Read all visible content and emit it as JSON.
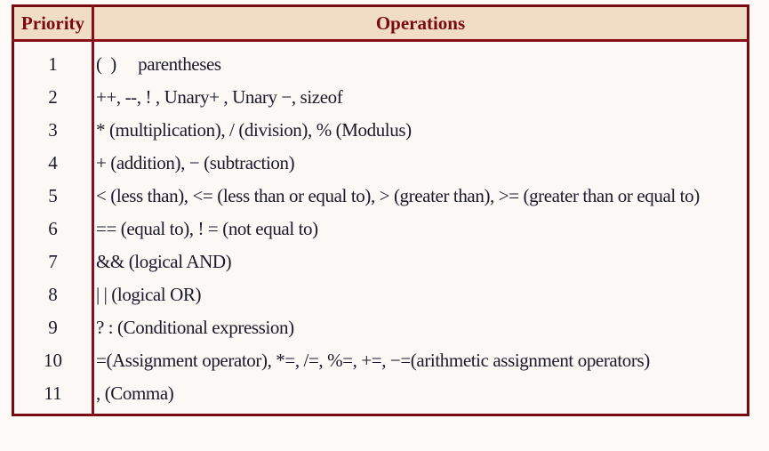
{
  "table": {
    "headers": {
      "priority": "Priority",
      "operations": "Operations"
    },
    "rows": [
      {
        "priority": "1",
        "operations": "(  )     parentheses"
      },
      {
        "priority": "2",
        "operations": "++, --, ! , Unary+ , Unary −, sizeof"
      },
      {
        "priority": "3",
        "operations": "* (multiplication), / (division), % (Modulus)"
      },
      {
        "priority": "4",
        "operations": "+ (addition), − (subtraction)"
      },
      {
        "priority": "5",
        "operations": "< (less than), <= (less than or equal to), > (greater than), >= (greater than or equal to)"
      },
      {
        "priority": "6",
        "operations": "== (equal to), ! = (not equal to)"
      },
      {
        "priority": "7",
        "operations": "&& (logical AND)"
      },
      {
        "priority": "8",
        "operations": "| | (logical OR)"
      },
      {
        "priority": "9",
        "operations": "? : (Conditional expression)"
      },
      {
        "priority": "10",
        "operations": "=(Assignment operator), *=, /=, %=, +=, −=(arithmetic assignment operators)"
      },
      {
        "priority": "11",
        "operations": ", (Comma)"
      }
    ]
  },
  "colors": {
    "border": "#8a0f18",
    "header_background": "#f1dcc6",
    "header_text": "#7a0a12",
    "body_background": "#fcf8f5"
  }
}
